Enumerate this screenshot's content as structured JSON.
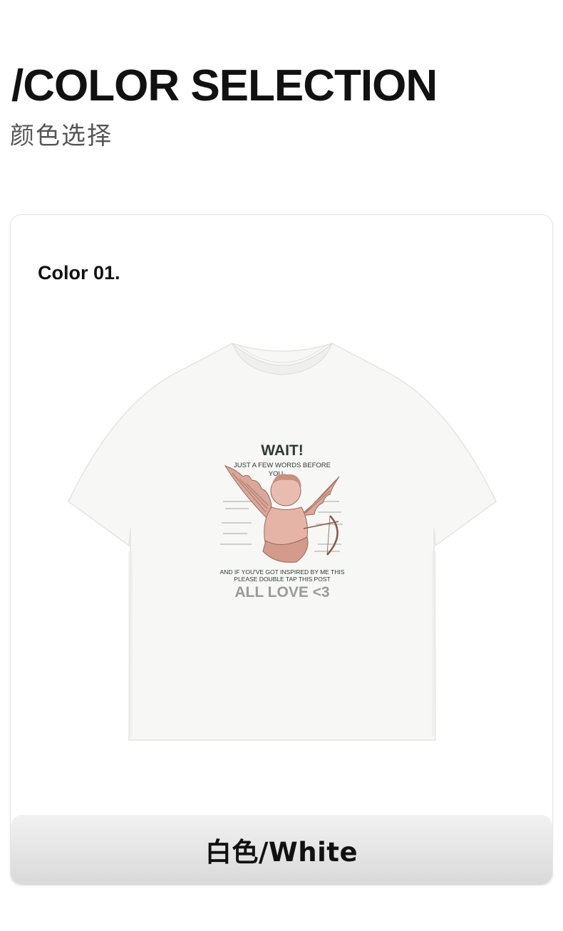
{
  "header": {
    "title": "/COLOR SELECTION",
    "subtitle": "颜色选择"
  },
  "card": {
    "color_label": "Color 01.",
    "color_name": "白色/White",
    "shirt_color": "#f7f7f5",
    "print": {
      "headline": "WAIT!",
      "line1": "JUST A FEW WORDS BEFORE",
      "line2": "YOU",
      "bottom1": "AND IF YOU'VE GOT INSPIRED BY ME THIS",
      "bottom2": "PLEASE DOUBLE TAP THIS POST",
      "tagline": "ALL LOVE <3"
    }
  }
}
